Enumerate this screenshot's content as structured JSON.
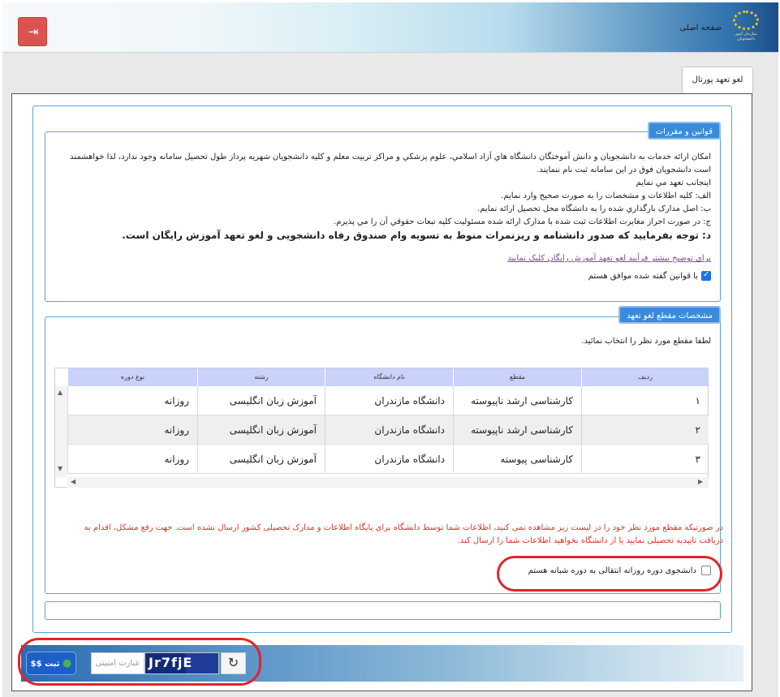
{
  "header": {
    "home_link": "صفحه اصلی",
    "logo_text": "سازمان امور دانشجویان",
    "exit_icon": "sign-out-icon"
  },
  "tab": {
    "label": "لغو تعهد پورتال"
  },
  "rules": {
    "legend": "قوانین و مقررات",
    "lines": [
      "امکان ارائه خدمات به دانشجويان و دانش آموختگان دانشگاه هاي آزاد اسلامي، علوم پزشکي و مراکز تربيت معلم و کليه دانشجويان شهريه پرداز طول تحصيل سامانه وجود ندارد، لذا خواهشمند است دانشجويان فوق در اين سامانه ثبت نام ننمايند.",
      "اينجانب تعهد مي نمايم",
      "الف: کليه اطلاعات و مشخصات را به صورت صحيح وارد نمايم.",
      "ب: اصل مدارک بارگذاري شده را به دانشگاه محل تحصيل ارائه نمايم.",
      "ج: در صورت احراز مغايرت اطلاعات ثبت شده با مدارک ارائه شده مسئوليت کليه تبعات حقوقي آن را مي پذيرم."
    ],
    "bold_line": "د: توجه بفرمایید که صدور دانشنامه و ریزنمرات منوط به تسویه وام صندوق رفاه دانشجویی و لغو تعهد آموزش رایگان است.",
    "more_link": "برای توضیح بیشتر فرآیند لغو تعهد آموزش رایگان کلیک نمایید",
    "agree_label": "با قوانین گفته شده موافق هستم",
    "agree_checked": true
  },
  "grade": {
    "legend": "مشخصات مقطع لغو تعهد",
    "hint": "لطفا مقطع مورد نظر را انتخاب نمائید.",
    "columns": [
      "ردیف",
      "مقطع",
      "نام دانشگاه",
      "رشته",
      "نوع دوره"
    ],
    "rows": [
      [
        "١",
        "کارشناسی ارشد ناپیوسته",
        "دانشگاه مازندران",
        "آموزش زبان انگلیسی",
        "روزانه"
      ],
      [
        "٢",
        "کارشناسی ارشد ناپیوسته",
        "دانشگاه مازندران",
        "آموزش زبان انگلیسی",
        "روزانه"
      ],
      [
        "٣",
        "کارشناسی پیوسته",
        "دانشگاه مازندران",
        "آموزش زبان  انگلیسی",
        "روزانه"
      ]
    ],
    "warning": "در صورتیکه مقطع مورد نظر خود را در لیست زیر مشاهده نمی کنید، اطلاعات شما توسط دانشگاه برای پایگاه اطلاعات و مدارک تحصیلی کشور ارسال نشده است. جهت رفع مشکل، اقدام به دریافت تاییدیه تحصیلی نمایید یا از دانشگاه بخواهید اطلاعات شما را ارسال کند.",
    "night_label": "دانشجوی دوره روزانه انتقالی به دوره شبانه هستم",
    "night_checked": false
  },
  "footer": {
    "submit_label": "ثبت",
    "submit_icon_text": "$$",
    "captcha_placeholder": "عبارت امنیتی",
    "captcha_text": "Jr7fjE",
    "refresh_glyph": "↻"
  },
  "colors": {
    "accent": "#3a8bd9",
    "warning": "#d9362b",
    "exit": "#d9534f",
    "highlight_oval": "#e0252b"
  }
}
